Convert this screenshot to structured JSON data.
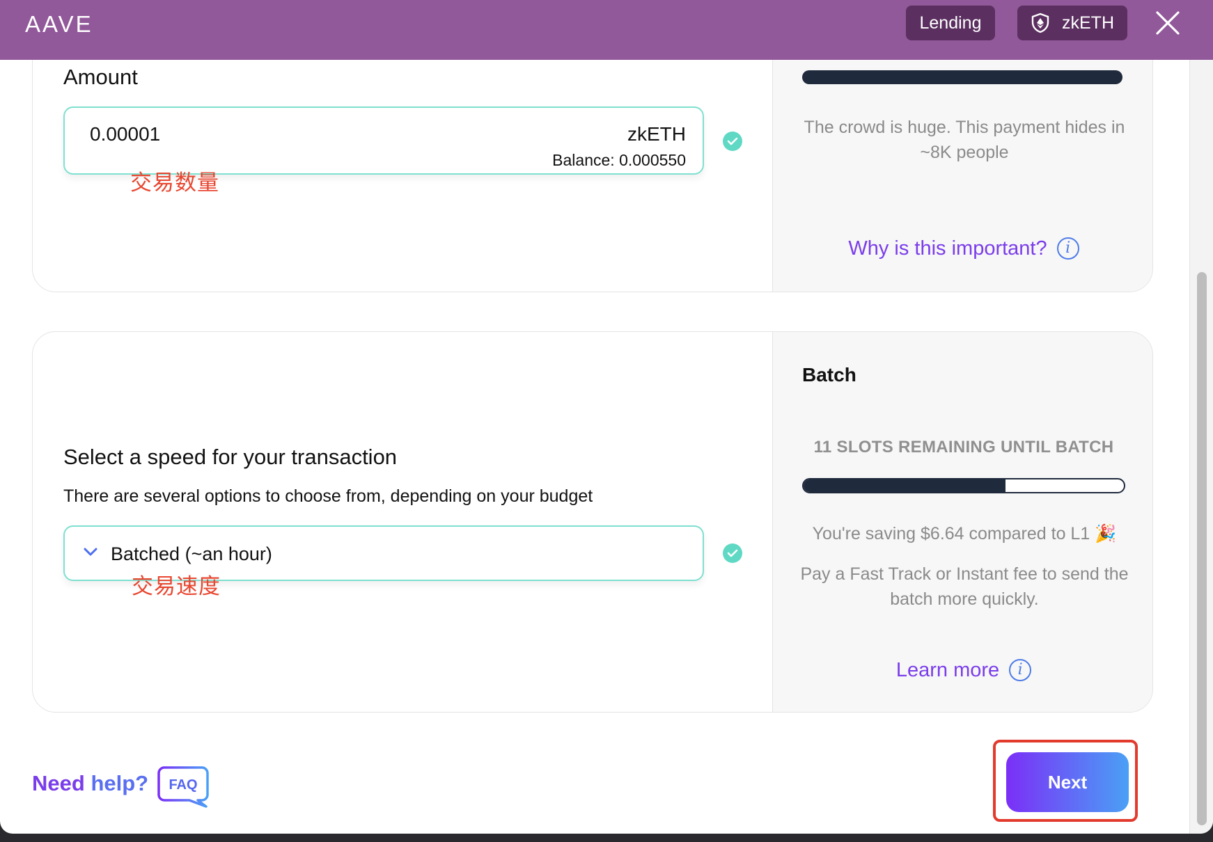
{
  "header": {
    "logo": "AAVE",
    "lending_label": "Lending",
    "token_label": "zkETH"
  },
  "amount_card": {
    "title": "Amount",
    "value": "0.00001",
    "unit": "zkETH",
    "balance": "Balance: 0.000550",
    "annotation": "交易数量",
    "privacy_text": "The crowd is huge. This payment hides in ~8K people",
    "link_label": "Why is this important?"
  },
  "speed_card": {
    "title": "Select a speed for your transaction",
    "description": "There are several options to choose from, depending on your budget",
    "selected_speed": "Batched (~an hour)",
    "annotation": "交易速度",
    "batch_title": "Batch",
    "slots_text": "11 SLOTS REMAINING UNTIL BATCH",
    "batch_progress_fraction": 0.63,
    "saving_text": "You're saving $6.64 compared to L1 🎉",
    "fee_text": "Pay a Fast Track or Instant fee to send the batch more quickly.",
    "link_label": "Learn more"
  },
  "footer": {
    "help_need": "Need",
    "help_word": "help?",
    "faq_label": "FAQ",
    "next_label": "Next"
  },
  "colors": {
    "header_bg": "#91589a",
    "accent_purple": "#7a3dea",
    "accent_blue": "#4aa0f5",
    "field_border": "#7ee0cf",
    "check": "#5fd9c4",
    "annotation_red": "#e8462f",
    "bar_dark": "#1f2a3d"
  }
}
